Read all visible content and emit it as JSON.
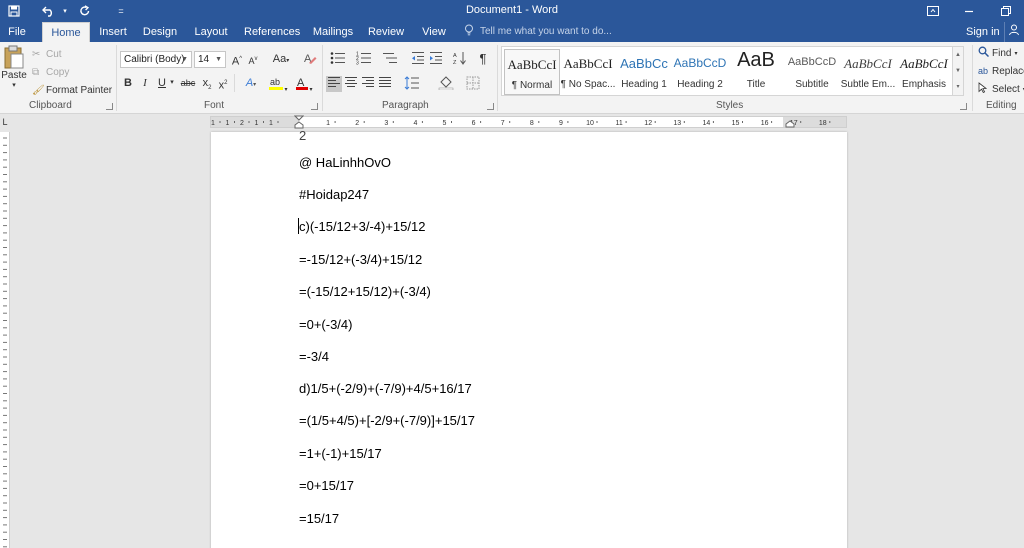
{
  "window": {
    "title": "Document1 - Word"
  },
  "ribbon_tabs": [
    {
      "label": "File"
    },
    {
      "label": "Home",
      "active": true
    },
    {
      "label": "Insert"
    },
    {
      "label": "Design"
    },
    {
      "label": "Layout"
    },
    {
      "label": "References"
    },
    {
      "label": "Mailings"
    },
    {
      "label": "Review"
    },
    {
      "label": "View"
    }
  ],
  "tell_me": {
    "placeholder": "Tell me what you want to do..."
  },
  "account": {
    "sign_in": "Sign in"
  },
  "clipboard": {
    "paste": "Paste",
    "cut": "Cut",
    "copy": "Copy",
    "format_painter": "Format Painter",
    "group_label": "Clipboard"
  },
  "font": {
    "family": "Calibri (Body)",
    "size": "14",
    "grow": "A",
    "shrink": "A",
    "change_case": "Aa",
    "bold": "B",
    "italic": "I",
    "underline": "U",
    "strike": "abc",
    "subscript": "x",
    "superscript": "x",
    "text_effects": "A",
    "font_color": "A",
    "group_label": "Font",
    "highlight_color": "#ffff00",
    "text_color": "#e00000"
  },
  "paragraph": {
    "group_label": "Paragraph",
    "show_marks": "¶"
  },
  "styles": {
    "group_label": "Styles",
    "items": [
      {
        "preview": "AaBbCcI",
        "name": "¶ Normal",
        "active": true
      },
      {
        "preview": "AaBbCcI",
        "name": "¶ No Spac..."
      },
      {
        "preview": "AaBbCc",
        "name": "Heading 1",
        "color": "#2e74b5"
      },
      {
        "preview": "AaBbCcD",
        "name": "Heading 2",
        "color": "#2e74b5"
      },
      {
        "preview": "AaB",
        "name": "Title"
      },
      {
        "preview": "AaBbCcD",
        "name": "Subtitle",
        "color": "#5a5a5a"
      },
      {
        "preview": "AaBbCcI",
        "name": "Subtle Em...",
        "color": "#404040"
      },
      {
        "preview": "AaBbCcI",
        "name": "Emphasis"
      }
    ]
  },
  "editing": {
    "find": "Find",
    "replace": "Replace",
    "select": "Select",
    "group_label": "Editing"
  },
  "ruler": {
    "ticks": [
      "1",
      "1",
      "2",
      "1",
      "1",
      "1",
      "2",
      "3",
      "4",
      "5",
      "6",
      "7",
      "8",
      "9",
      "10",
      "11",
      "12",
      "13",
      "14",
      "15",
      "16",
      "17",
      "18"
    ]
  },
  "document": {
    "paragraphs": [
      "2",
      "@ HaLinhhOvO",
      "#Hoidap247",
      "c)(-15/12+3/-4)+15/12",
      "=-15/12+(-3/4)+15/12",
      "=(-15/12+15/12)+(-3/4)",
      "=0+(-3/4)",
      "=-3/4",
      "d)1/5+(-2/9)+(-7/9)+4/5+16/17",
      "=(1/5+4/5)+[-2/9+(-7/9)]+15/17",
      "=1+(-1)+15/17",
      "=0+15/17",
      "=15/17"
    ]
  }
}
